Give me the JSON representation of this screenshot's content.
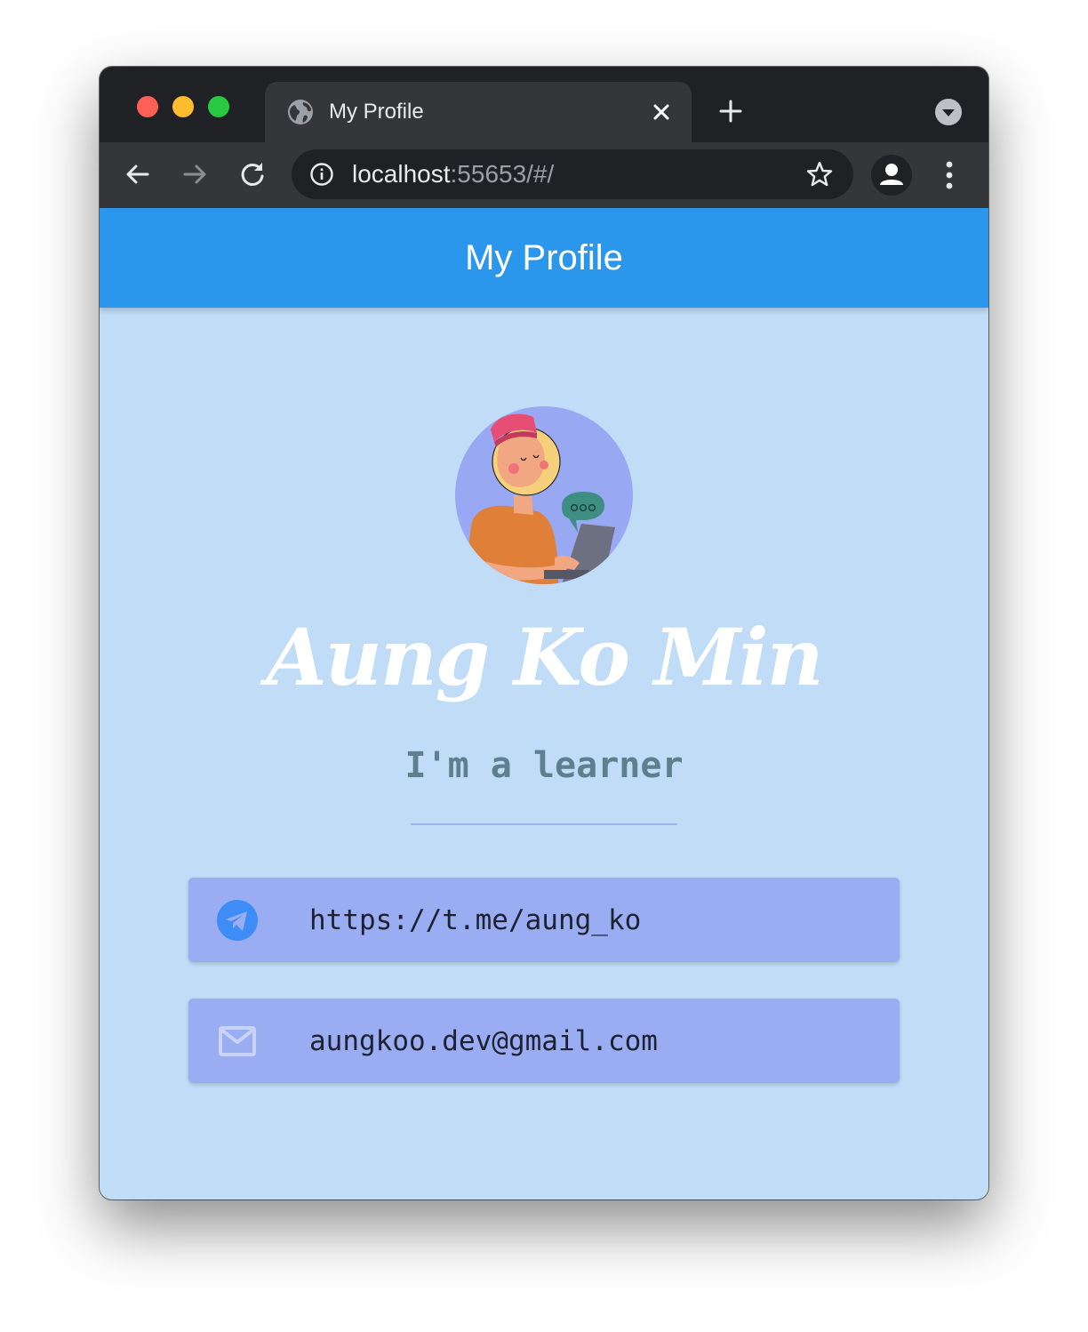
{
  "browser": {
    "tab": {
      "title": "My Profile"
    },
    "address_bar": {
      "host": "localhost",
      "path": ":55653/#/"
    }
  },
  "app": {
    "title": "My Profile",
    "profile": {
      "name": "Aung Ko Min",
      "tagline": "I'm a learner"
    },
    "contacts": [
      {
        "icon": "telegram-icon",
        "text": "https://t.me/aung_ko",
        "color": "#3e8cf6"
      },
      {
        "icon": "mail-icon",
        "text": "aungkoo.dev@gmail.com",
        "color": "#c8d3f8"
      }
    ]
  },
  "colors": {
    "app_bar": "#2b97ec",
    "background": "#c0dcf6",
    "card": "#9aadf3",
    "avatar_circle": "#99a8f2"
  }
}
